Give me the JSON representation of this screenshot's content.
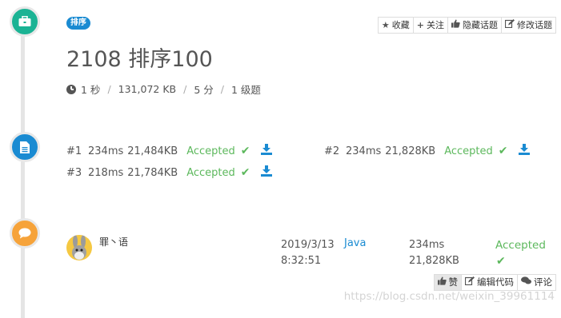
{
  "problem": {
    "tag": "排序",
    "title": "2108 排序100",
    "meta": {
      "time_limit": "1 秒",
      "memory_limit": "131,072 KB",
      "score": "5 分",
      "level": "1 级题"
    },
    "actions": {
      "favorite": "收藏",
      "follow": "关注",
      "hide_topic": "隐藏话题",
      "edit_topic": "修改话题"
    }
  },
  "testcases": [
    {
      "id": "#1",
      "time": "234ms",
      "memory": "21,484KB",
      "status": "Accepted"
    },
    {
      "id": "#2",
      "time": "234ms",
      "memory": "21,828KB",
      "status": "Accepted"
    },
    {
      "id": "#3",
      "time": "218ms",
      "memory": "21,784KB",
      "status": "Accepted"
    }
  ],
  "submission": {
    "username": "罪丶语",
    "date": "2019/3/13",
    "time": "8:32:51",
    "language": "Java",
    "runtime": "234ms",
    "memory": "21,828KB",
    "status": "Accepted",
    "actions": {
      "like": "赞",
      "edit_code": "编辑代码",
      "comment": "评论"
    }
  },
  "watermark": "https://blog.csdn.net/weixin_39961114",
  "colors": {
    "accent_blue": "#1a8bd2",
    "accepted_green": "#5cb85c",
    "comment_orange": "#f6a33a"
  }
}
